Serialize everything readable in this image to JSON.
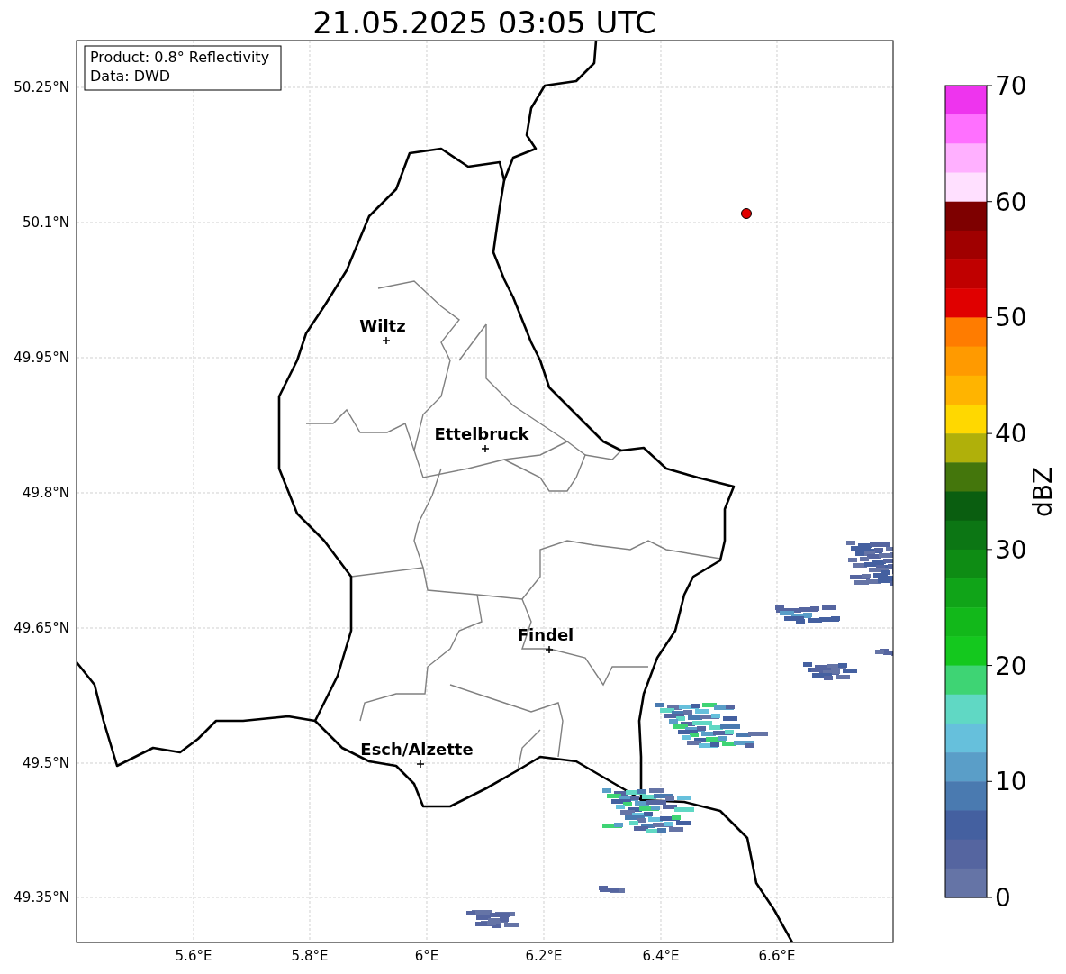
{
  "title": "21.05.2025 03:05 UTC",
  "info_box": [
    "Product: 0.8° Reflectivity",
    "Data: DWD"
  ],
  "y_ticks": [
    "50.25°N",
    "50.1°N",
    "49.95°N",
    "49.8°N",
    "49.65°N",
    "49.5°N",
    "49.35°N"
  ],
  "x_ticks": [
    "5.6°E",
    "5.8°E",
    "6°E",
    "6.2°E",
    "6.4°E",
    "6.6°E"
  ],
  "cities": [
    {
      "name": "Wiltz"
    },
    {
      "name": "Ettelbruck"
    },
    {
      "name": "Findel"
    },
    {
      "name": "Esch/Alzette"
    }
  ],
  "colorbar": {
    "label": "dBZ",
    "ticks": [
      "70",
      "60",
      "50",
      "40",
      "30",
      "20",
      "10",
      "0"
    ],
    "bins": [
      {
        "color": "#ee34ee"
      },
      {
        "color": "#ff70ff"
      },
      {
        "color": "#ffb0ff"
      },
      {
        "color": "#ffe0ff"
      },
      {
        "color": "#7e0000"
      },
      {
        "color": "#a00000"
      },
      {
        "color": "#c00000"
      },
      {
        "color": "#e00000"
      },
      {
        "color": "#ff7c00"
      },
      {
        "color": "#ff9a00"
      },
      {
        "color": "#ffb400"
      },
      {
        "color": "#ffd800"
      },
      {
        "color": "#b0b00a"
      },
      {
        "color": "#44760c"
      },
      {
        "color": "#0a5e10"
      },
      {
        "color": "#0c7614"
      },
      {
        "color": "#0e8c14"
      },
      {
        "color": "#10a418"
      },
      {
        "color": "#12b81a"
      },
      {
        "color": "#14c81e"
      },
      {
        "color": "#3ed474"
      },
      {
        "color": "#60d8c4"
      },
      {
        "color": "#66c0dc"
      },
      {
        "color": "#5a9ec8"
      },
      {
        "color": "#4a7ab0"
      },
      {
        "color": "#4460a0"
      },
      {
        "color": "#5565a0"
      },
      {
        "color": "#6574a6"
      }
    ]
  }
}
